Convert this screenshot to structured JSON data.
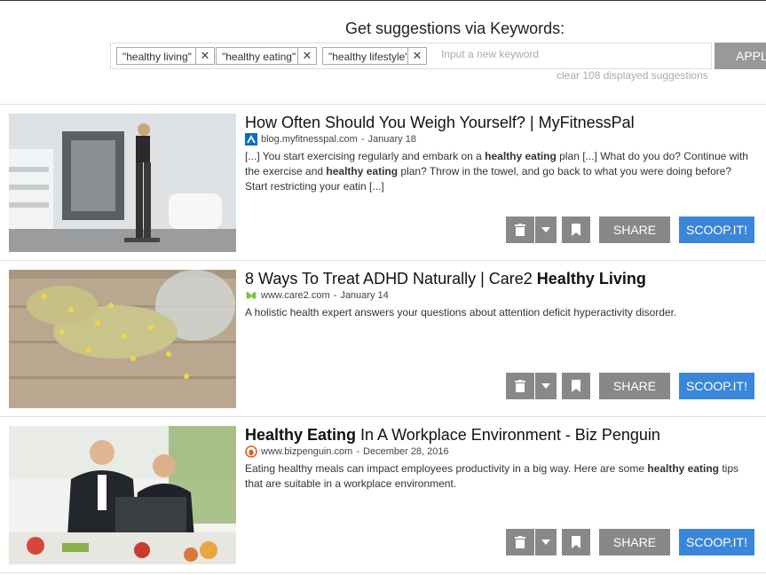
{
  "keywords": {
    "title": "Get suggestions via Keywords:",
    "tags": [
      "\"healthy living\"",
      "\"healthy eating\"",
      "\"healthy lifestyle\""
    ],
    "input_placeholder": "Input a new keyword",
    "apply_label": "APPLY",
    "clear_label": "clear 108 displayed suggestions"
  },
  "cards": [
    {
      "title_parts": [
        {
          "text": "How Often Should You Weigh Yourself? | MyFitnessPal",
          "bold": false
        }
      ],
      "favicon": "myfitnesspal-icon",
      "source": "blog.myfitnesspal.com",
      "date": "January 18",
      "snippet_parts": [
        {
          "text": "[...] You start exercising regularly and embark on a ",
          "bold": false
        },
        {
          "text": "healthy eating",
          "bold": true
        },
        {
          "text": " plan [...] What do you do? Continue with the exercise and ",
          "bold": false
        },
        {
          "text": "healthy eating",
          "bold": true
        },
        {
          "text": " plan? Throw in the towel, and go back to what you were doing before? Start restricting your eatin [...]",
          "bold": false
        }
      ]
    },
    {
      "title_parts": [
        {
          "text": "8 Ways To Treat ADHD Naturally | Care2 ",
          "bold": false
        },
        {
          "text": "Healthy Living",
          "bold": true
        }
      ],
      "favicon": "care2-butterfly-icon",
      "source": "www.care2.com",
      "date": "January 14",
      "snippet_parts": [
        {
          "text": "A holistic health expert answers your questions about attention deficit hyperactivity disorder.",
          "bold": false
        }
      ]
    },
    {
      "title_parts": [
        {
          "text": "Healthy Eating",
          "bold": true
        },
        {
          "text": " In A Workplace Environment - Biz Penguin",
          "bold": false
        }
      ],
      "favicon": "bizpenguin-icon",
      "source": "www.bizpenguin.com",
      "date": "December 28, 2016",
      "snippet_parts": [
        {
          "text": "Eating healthy meals can impact employees productivity in a big way. Here are some ",
          "bold": false
        },
        {
          "text": "healthy eating",
          "bold": true
        },
        {
          "text": " tips that are suitable in a workplace environment.",
          "bold": false
        }
      ]
    }
  ],
  "actions": {
    "share_label": "SHARE",
    "scoop_label": "SCOOP.IT!"
  },
  "colors": {
    "accent": "#3a86d8",
    "button_gray": "#888888"
  }
}
